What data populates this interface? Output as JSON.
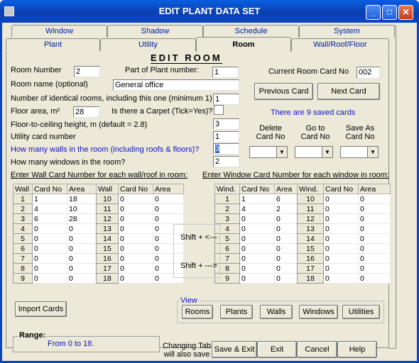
{
  "window": {
    "title": "EDIT PLANT DATA SET",
    "controls": [
      "minimize-icon",
      "maximize-icon",
      "close-icon"
    ]
  },
  "tabs_back": [
    "Window",
    "Shadow",
    "Schedule",
    "System"
  ],
  "tabs_front": [
    "Plant",
    "Utility",
    "Room",
    "Wall/Roof/Floor"
  ],
  "active_tab": "Room",
  "heading": "EDIT ROOM",
  "room_number": {
    "label": "Room Number",
    "value": "2"
  },
  "part_of_plant": {
    "label": "Part of Plant number:",
    "value": "1"
  },
  "current_card": {
    "label": "Current Room Card No",
    "value": "002"
  },
  "room_name": {
    "label": "Room name (optional)",
    "value": "General office"
  },
  "prev_card": "Previous Card",
  "next_card": "Next Card",
  "identical_rooms": {
    "label": "Number of identical rooms, including this one (minimum 1)",
    "value": "1"
  },
  "floor_area": {
    "label": "Floor area, m²",
    "value": "28"
  },
  "carpet": {
    "label": "Is there a Carpet (Tick=Yes)?",
    "checked": false
  },
  "saved_cards": "There are 9 saved cards",
  "ceiling_height": {
    "label": "Floor-to-ceiling height, m (default = 2.8)",
    "value": "3"
  },
  "utility_card": {
    "label": "Utility card number",
    "value": "1"
  },
  "walls_count": {
    "label": "How many walls in the room (including roofs & floors)?",
    "value": "3"
  },
  "windows_count": {
    "label": "How many windows in the room?",
    "value": "2"
  },
  "card_actions": {
    "delete": "Delete Card No",
    "goto": "Go to Card No",
    "saveas": "Save As Card No"
  },
  "wall_section_label": "Enter Wall Card Number for each wall/roof in room:",
  "window_section_label": "Enter Window Card Number for each window in room:",
  "wall_headers": [
    "Wall",
    "Card No",
    "Area"
  ],
  "window_headers": [
    "Wind.",
    "Card No",
    "Area"
  ],
  "walls_left": [
    [
      "1",
      "1",
      "18"
    ],
    [
      "2",
      "4",
      "10"
    ],
    [
      "3",
      "6",
      "28"
    ],
    [
      "4",
      "0",
      "0"
    ],
    [
      "5",
      "0",
      "0"
    ],
    [
      "6",
      "0",
      "0"
    ],
    [
      "7",
      "0",
      "0"
    ],
    [
      "8",
      "0",
      "0"
    ],
    [
      "9",
      "0",
      "0"
    ]
  ],
  "walls_right": [
    [
      "10",
      "0",
      "0"
    ],
    [
      "11",
      "0",
      "0"
    ],
    [
      "12",
      "0",
      "0"
    ],
    [
      "13",
      "0",
      "0"
    ],
    [
      "14",
      "0",
      "0"
    ],
    [
      "15",
      "0",
      "0"
    ],
    [
      "16",
      "0",
      "0"
    ],
    [
      "17",
      "0",
      "0"
    ],
    [
      "18",
      "0",
      "0"
    ]
  ],
  "windows_left": [
    [
      "1",
      "1",
      "6"
    ],
    [
      "2",
      "4",
      "2"
    ],
    [
      "3",
      "0",
      "0"
    ],
    [
      "4",
      "0",
      "0"
    ],
    [
      "5",
      "0",
      "0"
    ],
    [
      "6",
      "0",
      "0"
    ],
    [
      "7",
      "0",
      "0"
    ],
    [
      "8",
      "0",
      "0"
    ],
    [
      "9",
      "0",
      "0"
    ]
  ],
  "windows_right": [
    [
      "10",
      "0",
      "0"
    ],
    [
      "11",
      "0",
      "0"
    ],
    [
      "12",
      "0",
      "0"
    ],
    [
      "13",
      "0",
      "0"
    ],
    [
      "14",
      "0",
      "0"
    ],
    [
      "15",
      "0",
      "0"
    ],
    [
      "16",
      "0",
      "0"
    ],
    [
      "17",
      "0",
      "0"
    ],
    [
      "18",
      "0",
      "0"
    ]
  ],
  "shift_left": "Shift + <---",
  "shift_right": "Shift + --->",
  "import_cards": "Import Cards",
  "view": {
    "label": "View",
    "buttons": [
      "Rooms",
      "Plants",
      "Walls",
      "Windows",
      "Utilities"
    ]
  },
  "range": {
    "label": "Range:",
    "value": "From 0 to 18."
  },
  "changing_tab_note": "Changing Tab will also save",
  "footer_buttons": [
    "Save & Exit",
    "Exit",
    "Cancel",
    "Help"
  ]
}
